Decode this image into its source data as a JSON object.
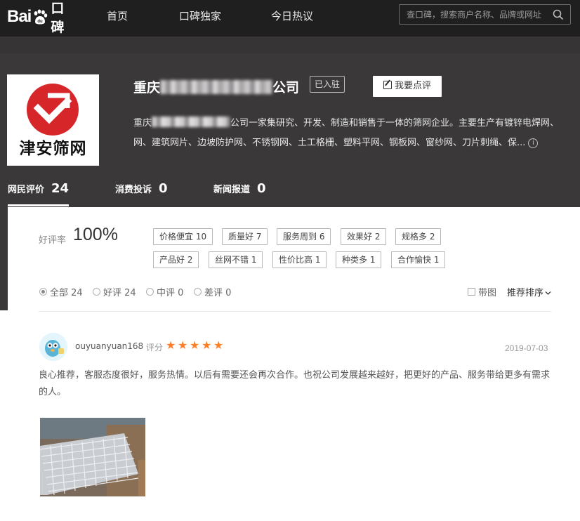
{
  "nav": {
    "logo_text": "Bai",
    "logo_suffix": "口碑",
    "items": [
      "首页",
      "口碑独家",
      "今日热议"
    ],
    "search_placeholder": "查口碑，搜索商户名称、品牌或网址"
  },
  "shop": {
    "name_prefix": "重庆",
    "name_suffix": "公司",
    "badge": "已入驻",
    "write_review": "我要点评",
    "logo_text": "津安筛网",
    "desc_line1_prefix": "重庆",
    "desc_line1_suffix": "公司一家集研究、开发、制造和销售于一体的筛网企业。主要生产有镀锌电焊网、",
    "desc_line2": "网、建筑网片、边坡防护网、不锈钢网、土工格栅、塑料平网、钢板网、窗纱网、刀片刺绳、保..."
  },
  "tabs": [
    {
      "label": "网民评价",
      "count": "24"
    },
    {
      "label": "消费投诉",
      "count": "0"
    },
    {
      "label": "新闻报道",
      "count": "0"
    }
  ],
  "rating": {
    "label": "好评率",
    "value": "100%"
  },
  "tags": [
    "价格便宜 10",
    "质量好 7",
    "服务周到 6",
    "效果好 2",
    "规格多 2",
    "产品好 2",
    "丝网不错 1",
    "性价比高 1",
    "种类多 1",
    "合作愉快 1"
  ],
  "filters": [
    {
      "label": "全部 24",
      "selected": true
    },
    {
      "label": "好评 24",
      "selected": false
    },
    {
      "label": "中评 0",
      "selected": false
    },
    {
      "label": "差评 0",
      "selected": false
    }
  ],
  "options": {
    "with_image": "带图",
    "sort": "推荐排序"
  },
  "review": {
    "username": "ouyuanyuan168",
    "score_label": "评分",
    "stars": 5,
    "date": "2019-07-03",
    "text": "良心推荐，客服态度很好，服务热情。以后有需要还会再次合作。也祝公司发展越来越好，把更好的产品、服务带给更多有需求的人。"
  },
  "colors": {
    "topbar": "#1f1f1f",
    "band": "#3a3839",
    "star": "#ff7f27",
    "logo_red": "#d7262a"
  }
}
